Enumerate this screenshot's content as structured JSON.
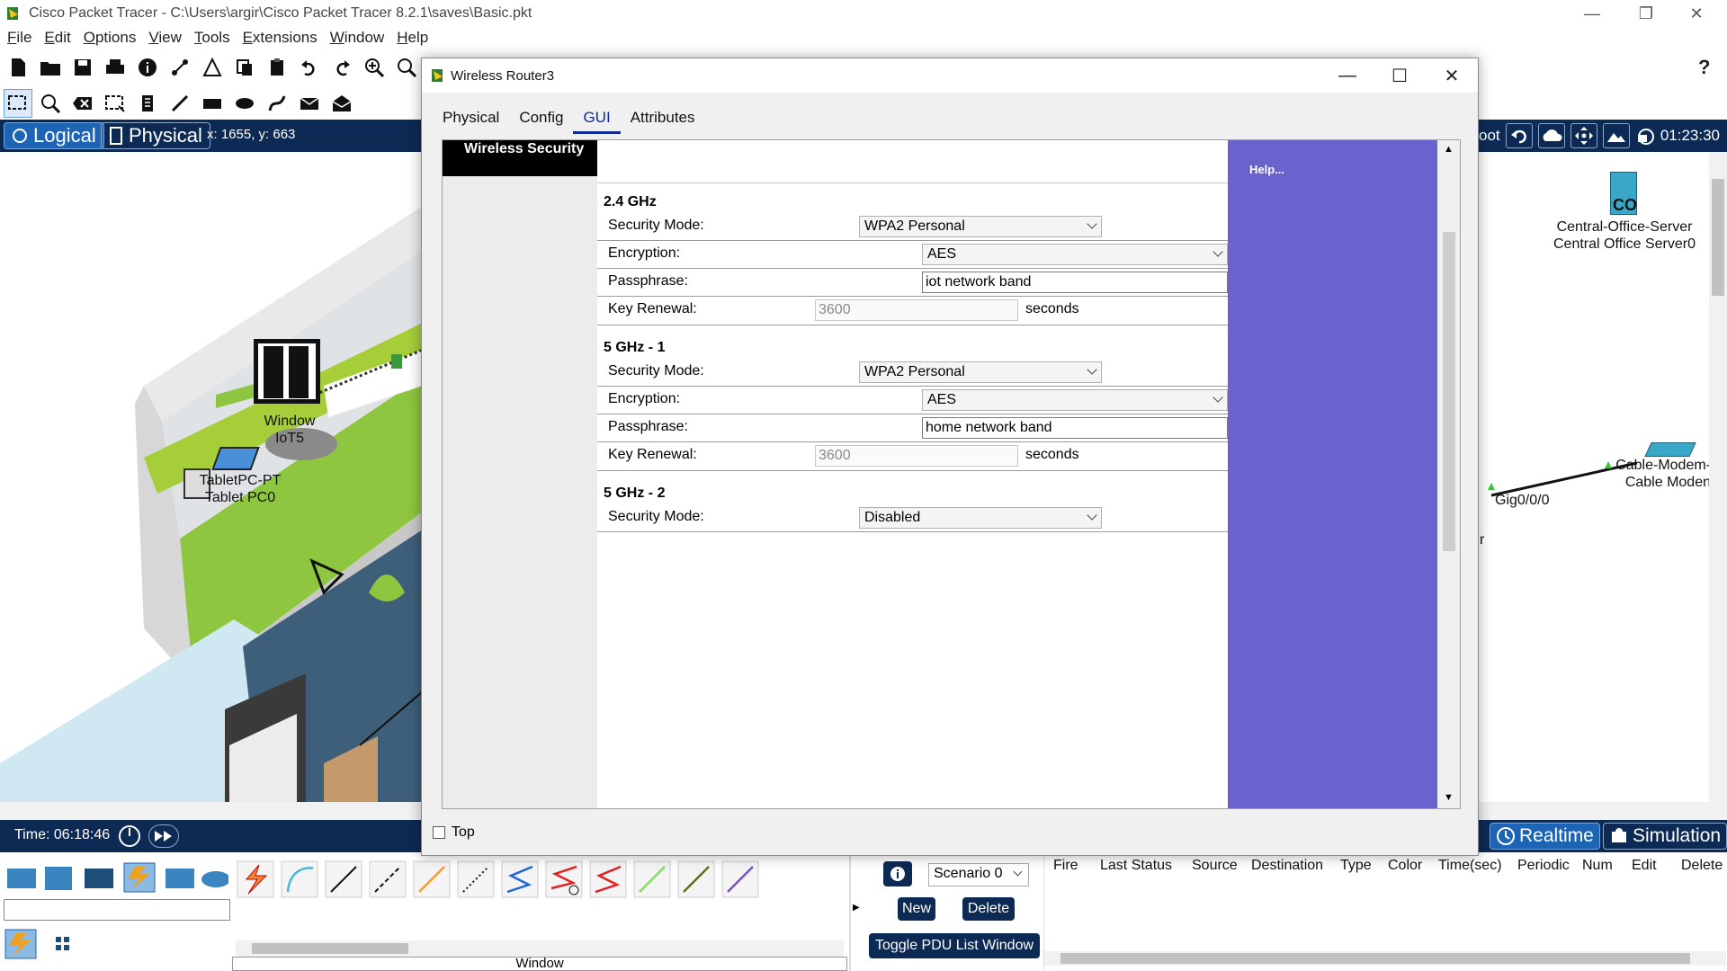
{
  "app": {
    "title": "Cisco Packet Tracer - C:\\Users\\argir\\Cisco Packet Tracer 8.2.1\\saves\\Basic.pkt",
    "menu": [
      "File",
      "Edit",
      "Options",
      "View",
      "Tools",
      "Extensions",
      "Window",
      "Help"
    ]
  },
  "viewbar": {
    "logical": "Logical",
    "physical": "Physical",
    "coords": "x: 1655, y: 663",
    "root_partial": "oot",
    "clock": "01:23:30"
  },
  "workspace": {
    "window_device": [
      "Window",
      "IoT5"
    ],
    "tablet_device": [
      "TabletPC-PT",
      "Tablet PC0"
    ],
    "server_device": [
      "Central-Office-Server",
      "Central Office Server0"
    ],
    "server_badge": "CO",
    "modem_device": [
      "Cable-Modem-",
      "Cable Moden"
    ],
    "port_label": "Gig0/0/0",
    "stray_text": "r"
  },
  "timebar": {
    "time": "Time: 06:18:46",
    "realtime": "Realtime",
    "simulation": "Simulation"
  },
  "bottom": {
    "scenario": "Scenario 0",
    "new": "New",
    "delete": "Delete",
    "toggle": "Toggle PDU List Window",
    "window_label": "Window",
    "pdu_columns": [
      "Fire",
      "Last Status",
      "Source",
      "Destination",
      "Type",
      "Color",
      "Time(sec)",
      "Periodic",
      "Num",
      "Edit",
      "Delete"
    ]
  },
  "dialog": {
    "title": "Wireless Router3",
    "tabs": [
      "Physical",
      "Config",
      "GUI",
      "Attributes"
    ],
    "active_tab": "GUI",
    "left_header": "Wireless Security",
    "help": "Help...",
    "top_checkbox": "Top",
    "sections": [
      {
        "title": "2.4 GHz",
        "security_mode_label": "Security Mode:",
        "security_mode": "WPA2 Personal",
        "encryption_label": "Encryption:",
        "encryption": "AES",
        "passphrase_label": "Passphrase:",
        "passphrase": "iot network band",
        "key_renewal_label": "Key Renewal:",
        "key_renewal": "3600",
        "key_renewal_unit": "seconds"
      },
      {
        "title": "5 GHz - 1",
        "security_mode_label": "Security Mode:",
        "security_mode": "WPA2 Personal",
        "encryption_label": "Encryption:",
        "encryption": "AES",
        "passphrase_label": "Passphrase:",
        "passphrase": "home network band",
        "key_renewal_label": "Key Renewal:",
        "key_renewal": "3600",
        "key_renewal_unit": "seconds"
      },
      {
        "title": "5 GHz - 2",
        "security_mode_label": "Security Mode:",
        "security_mode": "Disabled"
      }
    ]
  },
  "colors": {
    "navy": "#0d2a55",
    "help_panel": "#6a62cd",
    "lime": "#8ec63f"
  }
}
